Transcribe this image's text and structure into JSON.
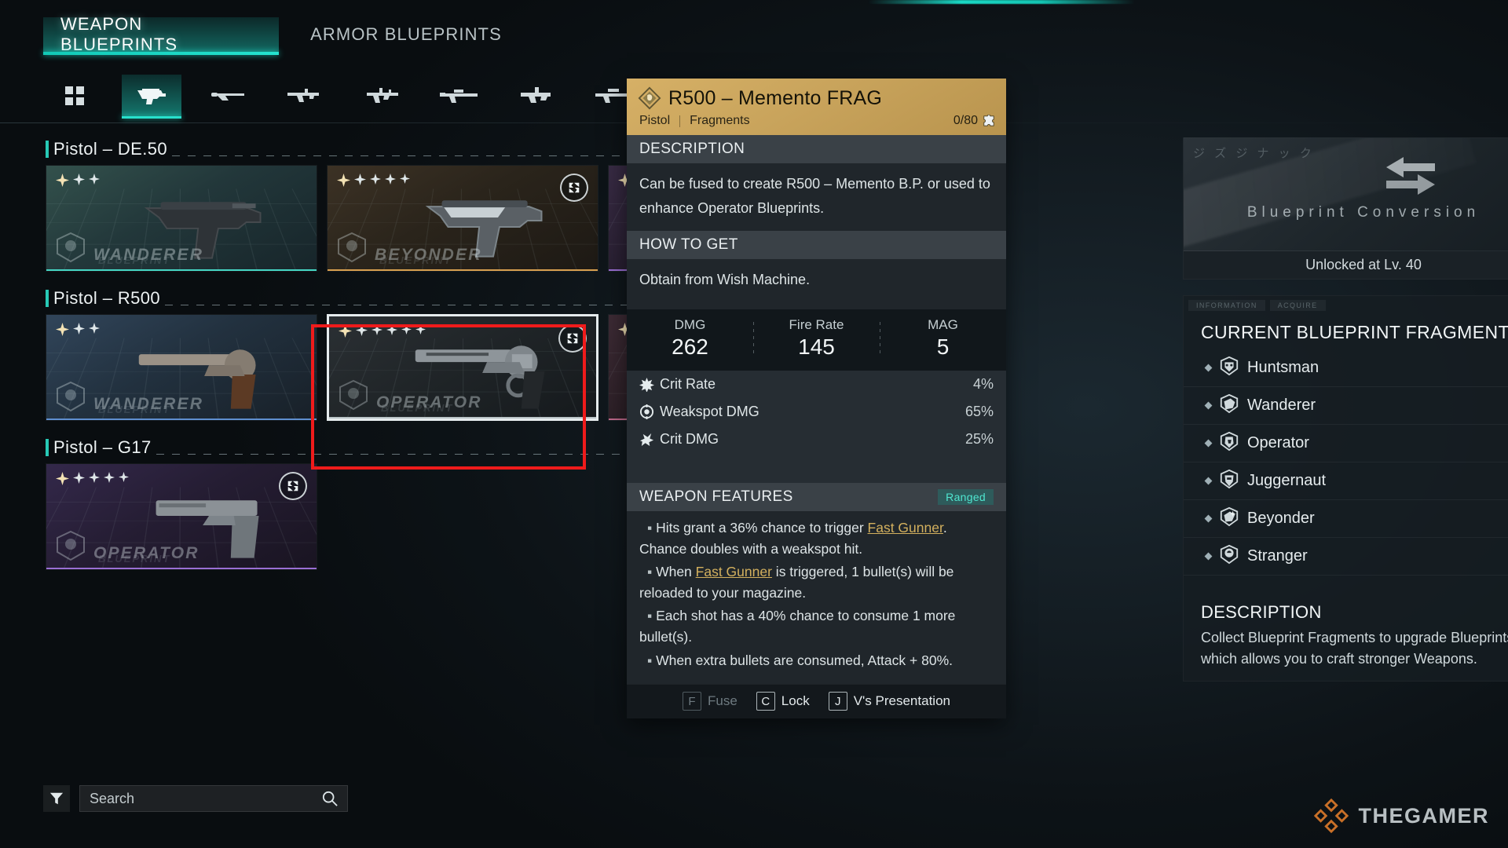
{
  "tabs": [
    {
      "id": "weapon",
      "label": "WEAPON BLUEPRINTS",
      "active": true
    },
    {
      "id": "armor",
      "label": "ARMOR BLUEPRINTS",
      "active": false
    }
  ],
  "categories": [
    {
      "name": "all-categories-icon",
      "active": false
    },
    {
      "name": "pistol-icon",
      "active": true
    },
    {
      "name": "shotgun-icon",
      "active": false
    },
    {
      "name": "smg-icon",
      "active": false
    },
    {
      "name": "assault-rifle-icon",
      "active": false
    },
    {
      "name": "marksman-rifle-icon",
      "active": false
    },
    {
      "name": "lmg-icon",
      "active": false
    },
    {
      "name": "sniper-rifle-icon",
      "active": false
    }
  ],
  "groups": [
    {
      "title": "Pistol – DE.50",
      "cards": [
        {
          "stars": 3,
          "blueprint": "WANDERER",
          "sub": "BLUEPRINT",
          "rarity_hex": "#2b4a46",
          "accent_hex": "#46d6c4",
          "locked": false,
          "selected": false,
          "gun": "desert-eagle"
        },
        {
          "stars": 5,
          "blueprint": "BEYONDER",
          "sub": "BLUEPRINT",
          "rarity_hex": "#3a2f22",
          "accent_hex": "#d8a050",
          "locked": true,
          "selected": false,
          "gun": "desert-eagle-skin"
        },
        {
          "stars": 5,
          "blueprint": "",
          "sub": "",
          "rarity_hex": "#2d2438",
          "accent_hex": "#9a6fd4",
          "locked": true,
          "selected": false,
          "gun": "desert-eagle-skin"
        }
      ]
    },
    {
      "title": "Pistol – R500",
      "cards": [
        {
          "stars": 3,
          "blueprint": "WANDERER",
          "sub": "BLUEPRINT",
          "rarity_hex": "#2b3a4a",
          "accent_hex": "#5f8fd0",
          "locked": false,
          "selected": false,
          "gun": "revolver"
        },
        {
          "stars": 6,
          "blueprint": "OPERATOR",
          "sub": "BLUEPRINT",
          "rarity_hex": "#23272b",
          "accent_hex": "#b9c3c6",
          "locked": true,
          "selected": true,
          "gun": "revolver-skin"
        },
        {
          "stars": 5,
          "blueprint": "",
          "sub": "",
          "rarity_hex": "#32252c",
          "accent_hex": "#c06a8c",
          "locked": true,
          "selected": false,
          "gun": "revolver-skin"
        }
      ]
    },
    {
      "title": "Pistol – G17",
      "cards": [
        {
          "stars": 5,
          "blueprint": "OPERATOR",
          "sub": "BLUEPRINT",
          "rarity_hex": "#2b2438",
          "accent_hex": "#9a6fd4",
          "locked": true,
          "selected": false,
          "gun": "glock"
        }
      ]
    }
  ],
  "search": {
    "value": "",
    "placeholder": "Search",
    "filter_name": "filter-icon",
    "search_icon": "search-icon"
  },
  "tooltip": {
    "title": "R500 – Memento FRAG",
    "type": "Pistol",
    "category": "Fragments",
    "count": "0/80",
    "rarity_hex": "#c9a45c",
    "description_header": "DESCRIPTION",
    "description_body": "Can be fused to create R500 – Memento B.P. or used to enhance Operator Blueprints.",
    "howto_header": "HOW TO GET",
    "howto_body": "Obtain from Wish Machine.",
    "stats": [
      {
        "label": "DMG",
        "value": "262"
      },
      {
        "label": "Fire Rate",
        "value": "145"
      },
      {
        "label": "MAG",
        "value": "5"
      }
    ],
    "modifiers": [
      {
        "icon": "crit-rate-icon",
        "label": "Crit Rate",
        "value": "4%"
      },
      {
        "icon": "weakspot-dmg-icon",
        "label": "Weakspot DMG",
        "value": "65%"
      },
      {
        "icon": "crit-dmg-icon",
        "label": "Crit DMG",
        "value": "25%"
      }
    ],
    "features_header": "WEAPON FEATURES",
    "features_tag": "Ranged",
    "features": [
      {
        "parts": [
          {
            "t": "Hits grant a 36% chance to trigger "
          },
          {
            "t": "Fast Gunner",
            "link": true
          },
          {
            "t": ". Chance doubles with a weakspot hit."
          }
        ]
      },
      {
        "parts": [
          {
            "t": "When "
          },
          {
            "t": "Fast Gunner",
            "link": true
          },
          {
            "t": " is triggered, 1 bullet(s) will be reloaded to your magazine."
          }
        ]
      },
      {
        "parts": [
          {
            "t": "Each shot has a 40% chance to consume 1 more bullet(s)."
          }
        ]
      },
      {
        "parts": [
          {
            "t": "When extra bullets are consumed, Attack + 80%."
          }
        ]
      }
    ],
    "keys": [
      {
        "key": "F",
        "label": "Fuse",
        "disabled": true
      },
      {
        "key": "C",
        "label": "Lock",
        "disabled": false
      },
      {
        "key": "J",
        "label": "V's Presentation",
        "disabled": false
      }
    ]
  },
  "right_panel": {
    "conversion_title": "Blueprint Conversion",
    "conversion_glyphs": "ジ ズ ジ ナ ッ ク",
    "unlock_text": "Unlocked at Lv. 40",
    "panel_tabs": [
      "INFORMATION",
      "ACQUIRE"
    ],
    "fragments_title": "CURRENT BLUEPRINT FRAGMENTS",
    "fragments": [
      {
        "name": "Huntsman",
        "icon": "huntsman-emblem-icon"
      },
      {
        "name": "Wanderer",
        "icon": "wanderer-emblem-icon"
      },
      {
        "name": "Operator",
        "icon": "operator-emblem-icon"
      },
      {
        "name": "Juggernaut",
        "icon": "juggernaut-emblem-icon"
      },
      {
        "name": "Beyonder",
        "icon": "beyonder-emblem-icon"
      },
      {
        "name": "Stranger",
        "icon": "stranger-emblem-icon"
      }
    ],
    "description_header": "DESCRIPTION",
    "description_body": "Collect Blueprint Fragments to upgrade Blueprints, which allows you to craft stronger Weapons."
  },
  "watermark": {
    "text": "THEGAMER",
    "accent_hex": "#d4762a"
  }
}
